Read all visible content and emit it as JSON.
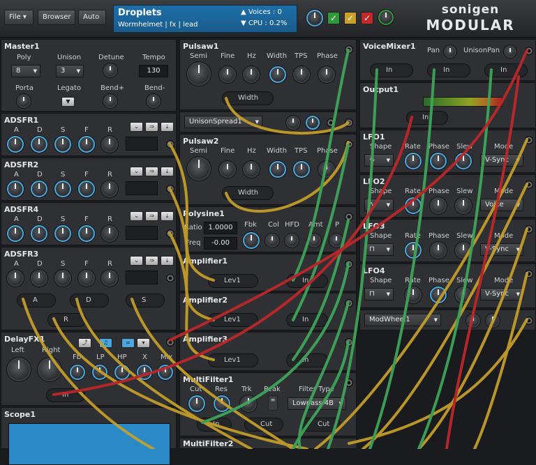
{
  "toolbar": {
    "file_label": "File",
    "browser_label": "Browser",
    "auto_label": "Auto",
    "preset_title": "Droplets",
    "preset_sub": "Wormhelmet | fx | lead",
    "voices_label": "Voices :",
    "voices_value": "0",
    "cpu_label": "CPU",
    "cpu_value": ": 0.2%"
  },
  "logo": {
    "line1": "sonigen",
    "line2": "MODULAR"
  },
  "master": {
    "title": "Master1",
    "poly_label": "Poly",
    "poly_value": "8",
    "unison_label": "Unison",
    "unison_value": "3",
    "detune_label": "Detune",
    "tempo_label": "Tempo",
    "tempo_value": "130",
    "porta_label": "Porta",
    "legato_label": "Legato",
    "bendp_label": "Bend+",
    "bendm_label": "Bend-"
  },
  "adsfr": [
    {
      "title": "ADSFR1"
    },
    {
      "title": "ADSFR2"
    },
    {
      "title": "ADSFR4"
    },
    {
      "title": "ADSFR3"
    }
  ],
  "adsfr_labels": {
    "a": "A",
    "d": "D",
    "s": "S",
    "f": "F",
    "r": "R"
  },
  "adsfr3_ports": {
    "a": "A",
    "d": "D",
    "s": "S",
    "r": "R"
  },
  "delay": {
    "title": "DelayFX1",
    "left": "Left",
    "right": "Right",
    "fb": "Fb",
    "lp": "LP",
    "hp": "HP",
    "x": "X",
    "mix": "Mix",
    "in": "In"
  },
  "scope": {
    "title": "Scope1"
  },
  "pulsaw1": {
    "title": "Pulsaw1",
    "semi": "Semi",
    "fine": "Fine",
    "hz": "Hz",
    "width": "Width",
    "tps": "TPS",
    "phase": "Phase",
    "port": "Width"
  },
  "unison_spread": {
    "label": "UnisonSpread1"
  },
  "pulsaw2": {
    "title": "Pulsaw2",
    "semi": "Semi",
    "fine": "Fine",
    "hz": "Hz",
    "width": "Width",
    "tps": "TPS",
    "phase": "Phase",
    "port": "Width"
  },
  "polysine": {
    "title": "Polysine1",
    "ratio_label": "Ratio",
    "ratio_value": "1.0000",
    "freq_label": "Freq",
    "freq_value": "-0.00",
    "fbk": "Fbk",
    "col": "Col",
    "hfd": "HFD",
    "amt": "Amt",
    "p": "P"
  },
  "amplifiers": [
    {
      "title": "Amplifier1",
      "lev": "Lev1",
      "in": "In"
    },
    {
      "title": "Amplifier2",
      "lev": "Lev1",
      "in": "In"
    },
    {
      "title": "Amplifier3",
      "lev": "Lev1",
      "in": "In"
    }
  ],
  "multifilter": {
    "title": "MultiFilter1",
    "cut": "Cut",
    "res": "Res",
    "trk": "Trk",
    "peak": "Peak",
    "filter_type": "Filter Type",
    "type_value": "Lowpass 4B",
    "in": "In",
    "cut_port": "Cut",
    "cut_port2": "Cut"
  },
  "multifilter2": {
    "title": "MultiFilter2"
  },
  "voicemixer": {
    "title": "VoiceMixer1",
    "pan": "Pan",
    "unisonpan": "UnisonPan",
    "in1": "In",
    "in2": "In",
    "in3": "In"
  },
  "output": {
    "title": "Output1",
    "in": "In"
  },
  "lfos": [
    {
      "title": "LFO1",
      "shape": "Shape",
      "rate": "Rate",
      "phase": "Phase",
      "slew": "Slew",
      "mode": "Mode",
      "mode_value": "V-Sync",
      "glyph": "∿"
    },
    {
      "title": "LFO2",
      "shape": "Shape",
      "rate": "Rate",
      "phase": "Phase",
      "slew": "Slew",
      "mode": "Mode",
      "mode_value": "Voice",
      "glyph": "∿"
    },
    {
      "title": "LFO3",
      "shape": "Shape",
      "rate": "Rate",
      "phase": "Phase",
      "slew": "Slew",
      "mode": "Mode",
      "mode_value": "V-Sync",
      "glyph": "⊓"
    },
    {
      "title": "LFO4",
      "shape": "Shape",
      "rate": "Rate",
      "phase": "Phase",
      "slew": "Slew",
      "mode": "Mode",
      "mode_value": "V-Sync",
      "glyph": "⊓"
    }
  ],
  "modwheel": {
    "title": "ModWheel1"
  },
  "colors": {
    "accent": "#4aa8e0",
    "wire_yellow": "#c8a02a",
    "wire_green": "#3fa85a",
    "wire_red": "#c0282a"
  }
}
